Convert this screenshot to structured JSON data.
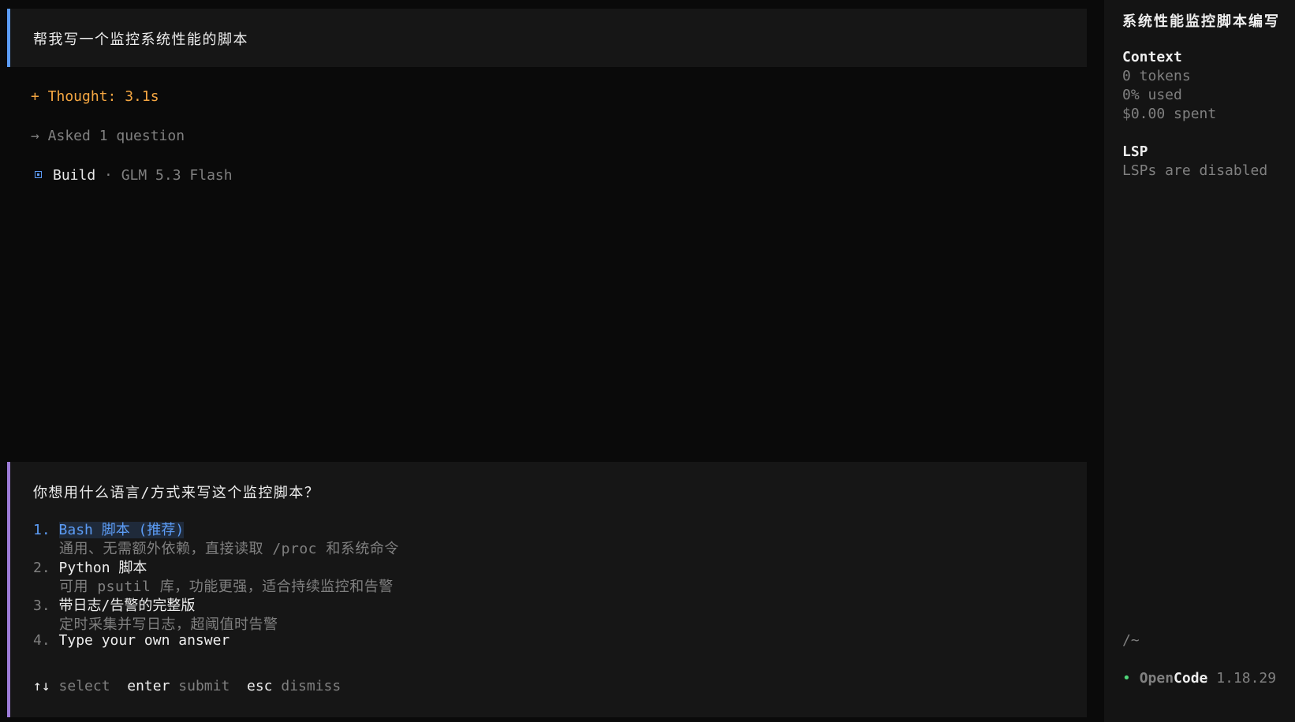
{
  "session": {
    "user_message": "帮我写一个监控系统性能的脚本",
    "thought": "+ Thought: 3.1s",
    "asked": "→ Asked 1 question",
    "build_label": "Build",
    "build_sep": " · ",
    "model": "GLM 5.3 Flash"
  },
  "question": {
    "title": "你想用什么语言/方式来写这个监控脚本？",
    "options": [
      {
        "num": "1.",
        "label": "Bash 脚本 (推荐)",
        "desc": "通用、无需额外依赖，直接读取 /proc 和系统命令"
      },
      {
        "num": "2.",
        "label": "Python 脚本",
        "desc": "可用 psutil 库，功能更强，适合持续监控和告警"
      },
      {
        "num": "3.",
        "label": "带日志/告警的完整版",
        "desc": "定时采集并写日志，超阈值时告警"
      },
      {
        "num": "4.",
        "label": "Type your own answer",
        "desc": ""
      }
    ],
    "hints": {
      "arrows": "↑↓",
      "select": "select",
      "enter": "enter",
      "submit": "submit",
      "esc": "esc",
      "dismiss": "dismiss"
    }
  },
  "sidebar": {
    "title": "系统性能监控脚本编写",
    "context_heading": "Context",
    "tokens": "0 tokens",
    "used": "0% used",
    "spent": "$0.00 spent",
    "lsp_heading": "LSP",
    "lsp_status": "LSPs are disabled",
    "path": "/~",
    "brand_dot": "•",
    "brand_open": "Open",
    "brand_code": "Code",
    "version": "1.18.29"
  },
  "colors": {
    "accent_blue": "#5c9cf5",
    "accent_purple": "#9d7cd8",
    "thought_orange": "#f5a742",
    "status_green": "#4fd67a"
  }
}
